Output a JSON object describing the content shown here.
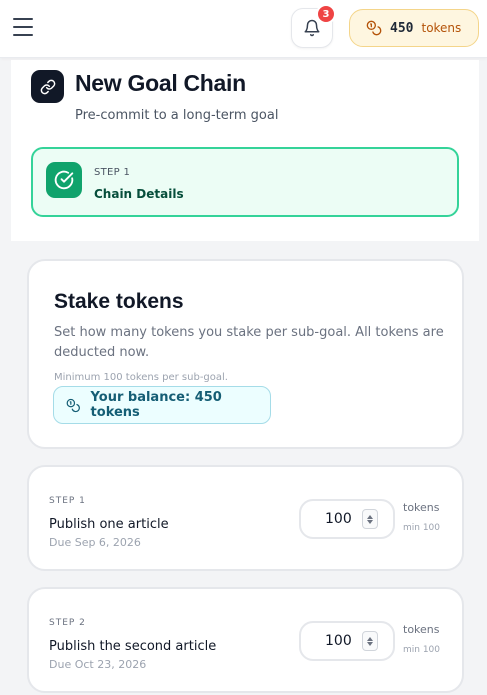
{
  "header": {
    "notifications_count": "3",
    "token_balance": "450",
    "token_unit": "tokens"
  },
  "page": {
    "title": "New Goal Chain",
    "subtitle": "Pre-commit to a long-term goal"
  },
  "step_indicator": {
    "step": "STEP 1",
    "title": "Chain Details"
  },
  "stake": {
    "title": "Stake tokens",
    "description": "Set how many tokens you stake per sub-goal. All tokens are deducted now.",
    "minimum_note": "Minimum 100 tokens per sub-goal.",
    "balance_text": "Your balance: 450 tokens"
  },
  "sub_goals": [
    {
      "step": "STEP 1",
      "name": "Publish one article",
      "due": "Due Sep 6, 2026",
      "amount": "100",
      "unit": "tokens",
      "min": "min 100"
    },
    {
      "step": "STEP 2",
      "name": "Publish the second article",
      "due": "Due Oct 23, 2026",
      "amount": "100",
      "unit": "tokens",
      "min": "min 100"
    }
  ],
  "colors": {
    "accent_green": "#10a36c",
    "badge_red": "#ef4444",
    "token_amber": "#b45309"
  },
  "icons": {
    "menu": "hamburger-menu-icon",
    "bell": "bell-icon",
    "coins": "coins-icon",
    "link": "link-icon",
    "check": "check-circle-icon"
  }
}
